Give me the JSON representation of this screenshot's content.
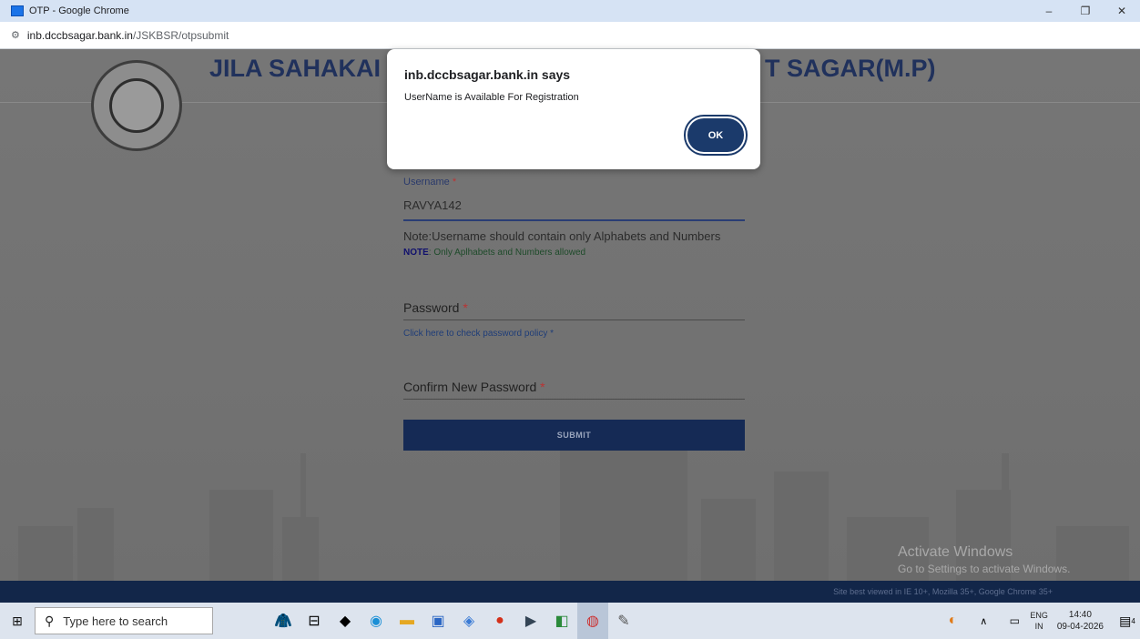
{
  "window": {
    "title": "OTP - Google Chrome",
    "controls": {
      "minimize": "–",
      "maximize": "❐",
      "close": "✕"
    }
  },
  "address_bar": {
    "host": "inb.dccbsagar.bank.in",
    "path": "/JSKBSR/otpsubmit"
  },
  "header": {
    "title_left": "JILA SAHAKAI",
    "title_right": "T SAGAR(M.P)"
  },
  "form": {
    "username_label": "Username",
    "required_mark": "*",
    "username_value": "RAVYA142",
    "note_main": "Note:Username should contain only Alphabets and Numbers",
    "note_bold": "NOTE",
    "note_small": ": Only Aplhabets and Numbers allowed",
    "password_label": "Password",
    "password_policy_link": "Click here to check password policy *",
    "confirm_label": "Confirm New Password",
    "submit_label": "SUBMIT"
  },
  "dialog": {
    "title": "inb.dccbsagar.bank.in says",
    "message": "UserName is Available For Registration",
    "ok_label": "OK"
  },
  "watermark": {
    "line1": "Activate Windows",
    "line2": "Go to Settings to activate Windows."
  },
  "footer": {
    "text": "Site best viewed in IE 10+, Mozilla 35+, Google Chrome 35+"
  },
  "taskbar": {
    "search_placeholder": "Type here to search",
    "lang_top": "ENG",
    "lang_bottom": "IN",
    "time": "14:40",
    "date": "09-04-2026",
    "notification_count": "4"
  }
}
